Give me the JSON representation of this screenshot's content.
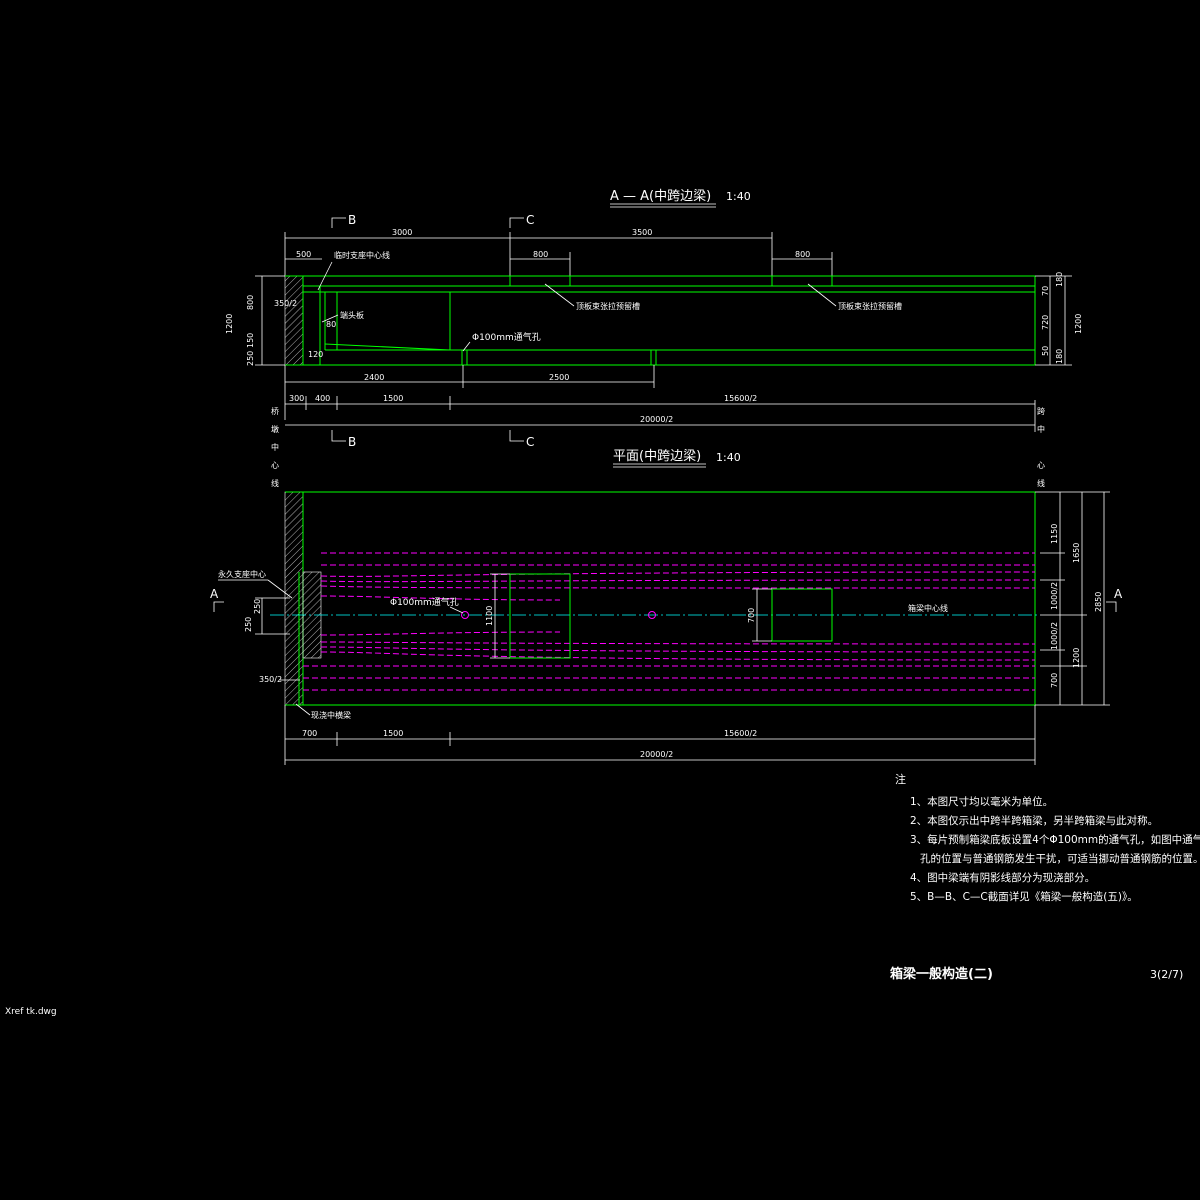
{
  "section_view": {
    "title": "A — A(中跨边梁)",
    "scale": "1:40",
    "cut_b": "B",
    "cut_c": "C",
    "top_dims": [
      "500",
      "3000",
      "3500"
    ],
    "top_sub_dims": [
      "800",
      "800"
    ],
    "labels": {
      "support_center": "临时支座中心线",
      "roof_anchor_1": "顶板束张拉预留槽",
      "roof_anchor_2": "顶板束张拉预留槽",
      "end_plate": "端头板",
      "vent_hole": "Φ100mm通气孔"
    },
    "left_dims": [
      "1200",
      "800",
      "350/2",
      "250",
      "150",
      "80",
      "120"
    ],
    "right_dims": [
      "70",
      "720",
      "50",
      "180",
      "180",
      "1200",
      "180"
    ],
    "bottom_dims_row1": [
      "2400",
      "2500"
    ],
    "bottom_dims_row2": [
      "300",
      "400",
      "1500",
      "15600/2"
    ],
    "total_dim": "20000/2",
    "left_vertical": [
      "桥",
      "墩",
      "中",
      "心",
      "线"
    ],
    "right_vertical": [
      "跨",
      "中",
      "心",
      "线"
    ]
  },
  "plan_view": {
    "title": "平面(中跨边梁)",
    "scale": "1:40",
    "cut_a": "A",
    "labels": {
      "permanent_support": "永久支座中心",
      "vent_hole": "Φ100mm通气孔",
      "beam_centerline": "箱梁中心线",
      "cast_in_place": "现浇中横梁"
    },
    "inner_dims": [
      "1100",
      "700"
    ],
    "left_dims": [
      "250",
      "250",
      "350/2"
    ],
    "right_dims": [
      "1150",
      "1000/2",
      "1000/2",
      "700",
      "1650",
      "1200",
      "2850"
    ],
    "bottom_dims": [
      "700",
      "1500",
      "15600/2"
    ],
    "total_dim": "20000/2"
  },
  "notes": {
    "heading": "注",
    "items": [
      "1、本图尺寸均以毫米为单位。",
      "2、本图仅示出中跨半跨箱梁，另半跨箱梁与此对称。",
      "3、每片预制箱梁底板设置4个Φ100mm的通气孔，如图中通气",
      "   孔的位置与普通钢筋发生干扰，可适当挪动普通钢筋的位置。",
      "4、图中梁端有阴影线部分为现浇部分。",
      "5、B—B、C—C截面详见《箱梁一般构造(五)》。"
    ]
  },
  "title_block": {
    "drawing_title": "箱梁一般构造(二)",
    "sheet_no": "3(2/7)",
    "xref": "Xref tk.dwg"
  },
  "colors": {
    "background": "#000000",
    "outline": "#00ff00",
    "tendon": "#ff00ff",
    "centerline": "#00ffff",
    "text": "#ffffff"
  }
}
